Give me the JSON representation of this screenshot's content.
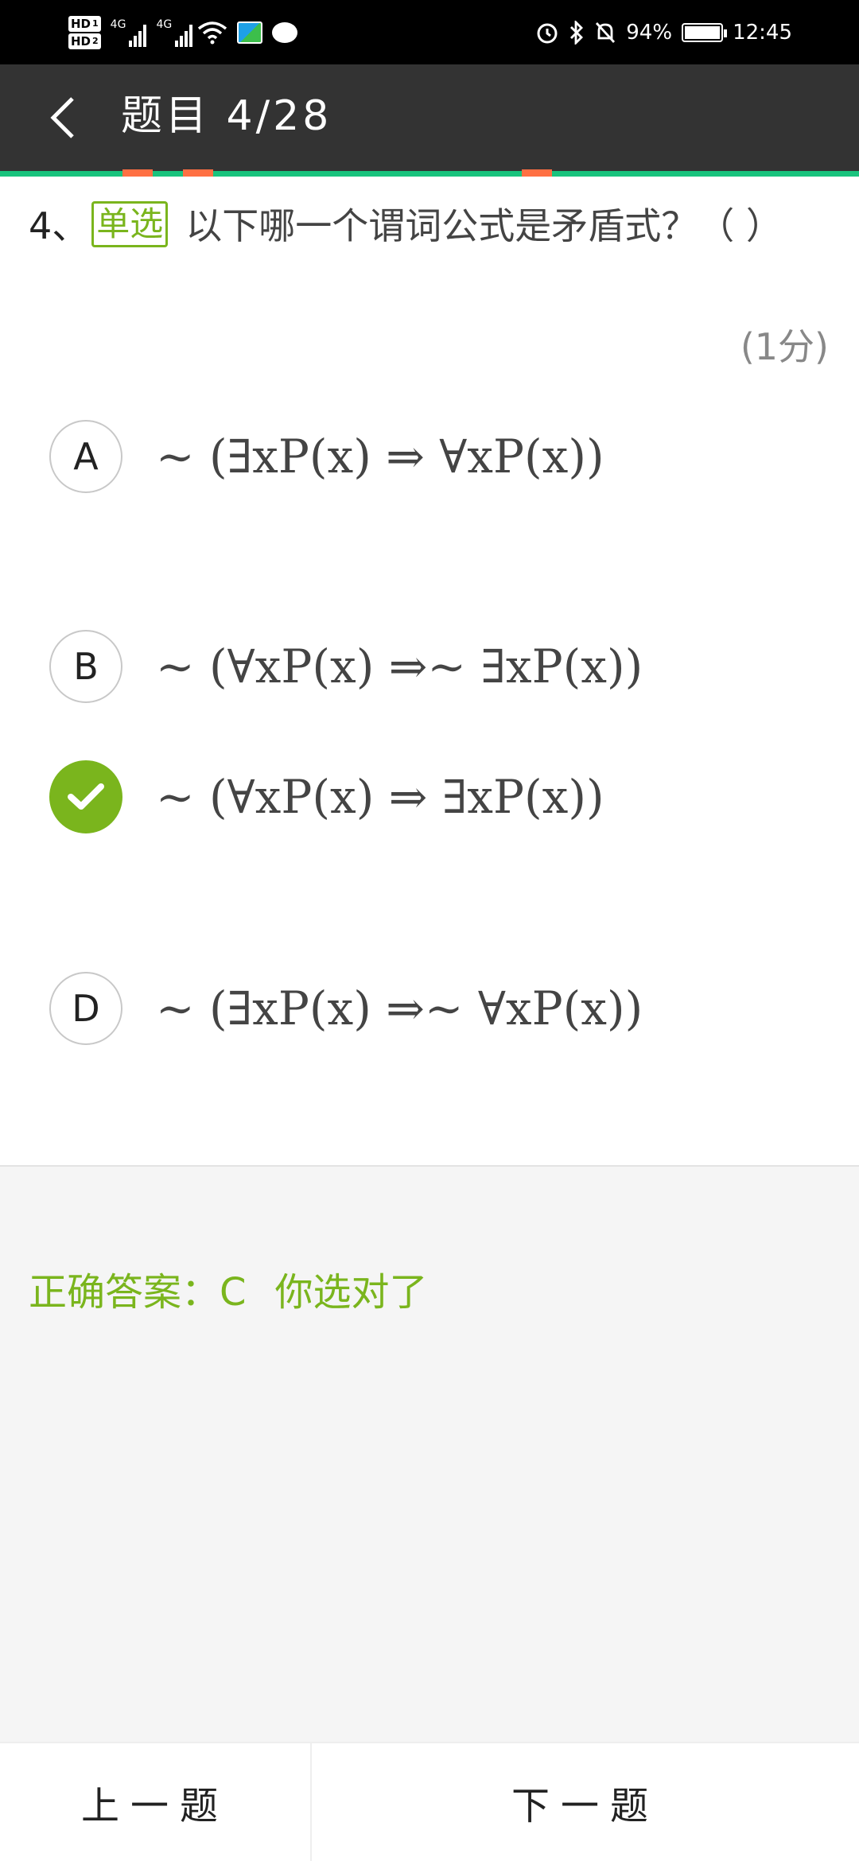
{
  "status_bar": {
    "hd1": "HD",
    "hd1_sub": "1",
    "hd2": "HD",
    "hd2_sub": "2",
    "net1": "4G",
    "net2": "4G",
    "battery_percent": "94%",
    "time": "12:45",
    "icons": [
      "alarm-icon",
      "bluetooth-icon",
      "mute-icon",
      "battery-icon",
      "wifi-icon",
      "signal-icon",
      "chat-icon"
    ]
  },
  "header": {
    "title": "题目 4/28",
    "accent_color": "#19c37d",
    "marker_color": "#ff7043"
  },
  "question": {
    "number": "4、",
    "type_tag": "单选",
    "text": "以下哪一个谓词公式是矛盾式？（ ）",
    "score": "(1分)"
  },
  "options": [
    {
      "label": "A",
      "formula": "∼ (∃xP(x) ⇒ ∀xP(x))",
      "selected": false
    },
    {
      "label": "B",
      "formula": "∼ (∀xP(x) ⇒∼ ∃xP(x))",
      "selected": false
    },
    {
      "label": "C",
      "formula": "∼ (∀xP(x) ⇒ ∃xP(x))",
      "selected": true
    },
    {
      "label": "D",
      "formula": "∼ (∃xP(x) ⇒∼ ∀xP(x))",
      "selected": false
    }
  ],
  "answer": {
    "correct_answer": "正确答案：C",
    "feedback": "你选对了",
    "color": "#7ab51d"
  },
  "nav": {
    "prev_label": "上一题",
    "next_label": "下一题"
  }
}
